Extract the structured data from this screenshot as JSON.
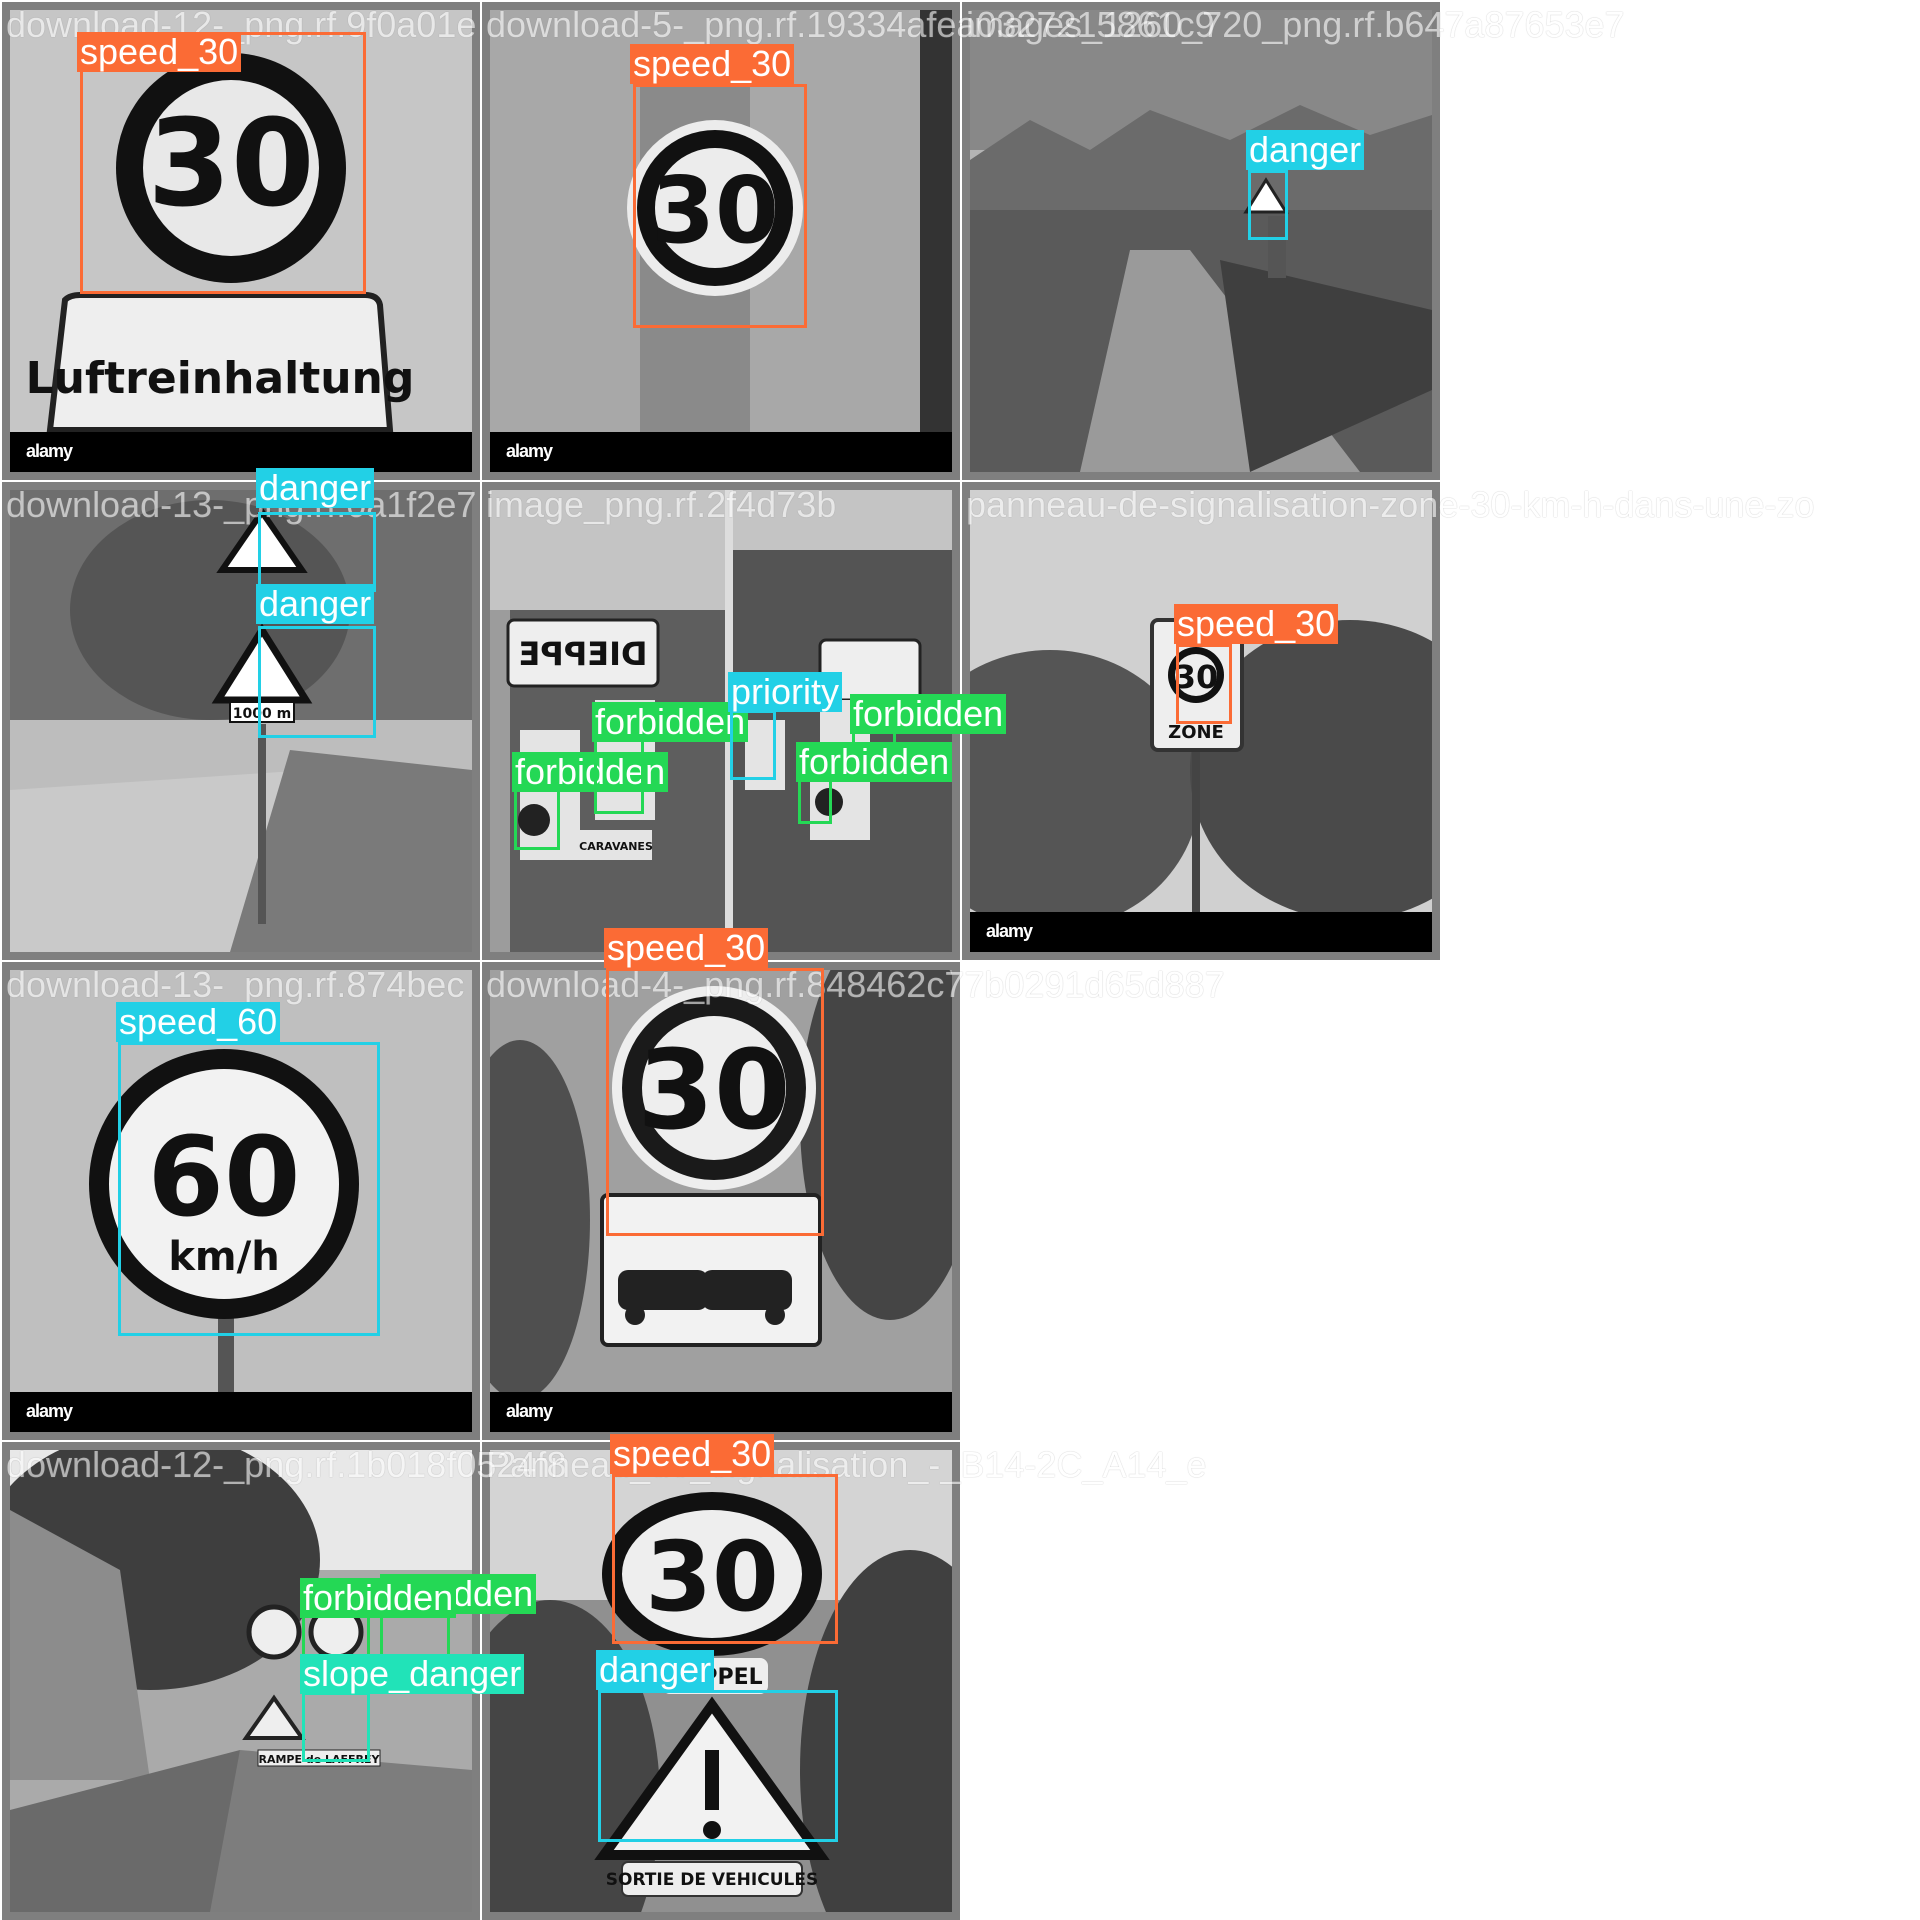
{
  "tiles": [
    {
      "filename": "download-12-_png.rf.9f0a01e",
      "watermark": "alamy",
      "sign_text": "Luftreinhaltung",
      "number": "30"
    },
    {
      "filename": "download-5-_png.rf.19334afea0327215861c9",
      "watermark": "alamy",
      "number": "30"
    },
    {
      "filename": "images_1260_720_png.rf.b647a87653e7"
    },
    {
      "filename": "download-13-_png.rf.0a1f2e7"
    },
    {
      "filename": "image_png.rf.2f4d73b",
      "sign_text": "DIEPPE",
      "sign_text_2": "CARAVANES"
    },
    {
      "filename": "panneau-de-signalisation-zone-30-km-h-dans-une-zo",
      "watermark": "alamy",
      "number": "30",
      "sign_text": "ZONE"
    },
    {
      "filename": "download-13-_png.rf.874bec",
      "watermark": "alamy",
      "number": "60",
      "unit": "km/h"
    },
    {
      "filename": "download-4-_png.rf.848462c77b0291d65d887",
      "watermark": "alamy",
      "number": "30"
    },
    {
      "filename": "download-12-_png.rf.1b018f0524f8"
    },
    {
      "filename": "Panneau_de_signalisation_-_B14-2C_A14_e",
      "number": "30",
      "sign_text": "RAPPEL",
      "sign_text_2": "SORTIE DE VEHICULES"
    }
  ],
  "road_text": "RAMPE de LAFFREY",
  "distance_text": "1000 m",
  "detections": {
    "d1": "speed_30",
    "d2": "speed_30",
    "d3": "danger",
    "d4": "danger",
    "d5": "danger",
    "d6": "forbidden",
    "d7": "forbidden",
    "d8": "priority",
    "d9": "forbidden",
    "d10": "forbidden",
    "d11": "speed_30",
    "d12": "speed_60",
    "d13": "speed_30",
    "d14": "forbidden",
    "d15": "forbidden",
    "d16": "slope_danger",
    "d17": "speed_30",
    "d18": "danger"
  },
  "colors": {
    "speed_30": "#fb6b35",
    "danger": "#22d0e6",
    "speed_60": "#22d0e6",
    "forbidden": "#24d855",
    "priority": "#22d0e6",
    "slope_danger": "#21e3b8"
  }
}
